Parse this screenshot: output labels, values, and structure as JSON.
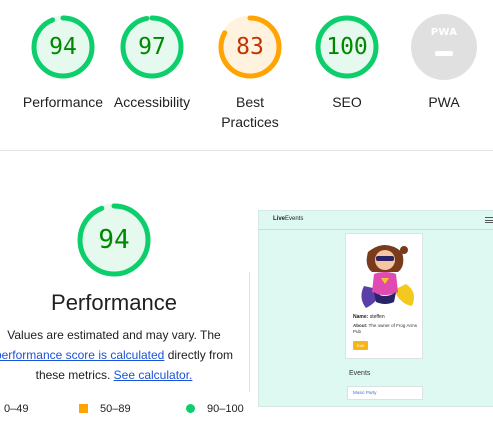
{
  "summary": {
    "gauges": [
      {
        "score": "94",
        "label": "Performance",
        "value": 94,
        "stroke": "#0cce6b",
        "fill": "#e5f9ee",
        "text": "#008800"
      },
      {
        "score": "97",
        "label": "Accessibility",
        "value": 97,
        "stroke": "#0cce6b",
        "fill": "#e5f9ee",
        "text": "#008800"
      },
      {
        "score": "83",
        "label": "Best Practices",
        "value": 83,
        "stroke": "#ffa400",
        "fill": "#fff3e0",
        "text": "#c33300"
      },
      {
        "score": "100",
        "label": "SEO",
        "value": 100,
        "stroke": "#0cce6b",
        "fill": "#e5f9ee",
        "text": "#008800"
      }
    ],
    "pwa": {
      "badge": "PWA",
      "label": "PWA"
    }
  },
  "detail": {
    "score": "94",
    "value": 94,
    "title": "Performance",
    "desc_1": "Values are estimated and may vary. The",
    "link_1": "performance score is calculated",
    "desc_2": " directly from",
    "desc_3": "these metrics.",
    "link_2": "See calculator."
  },
  "legend": {
    "fail": "0–49",
    "average": "50–89",
    "pass": "90–100"
  },
  "screenshot": {
    "brand_bold": "Live",
    "brand_rest": "Events",
    "name_label": "Name:",
    "name_value": "steffen",
    "about_label": "About:",
    "about_value": "The owner of Frog Arms Pub",
    "button": "Edit",
    "events_heading": "Events",
    "event_item": "Music Party"
  },
  "colors": {
    "pass": "#0cce6b",
    "average": "#ffa400",
    "fail": "#ff4e42",
    "link": "#1a53d8"
  }
}
